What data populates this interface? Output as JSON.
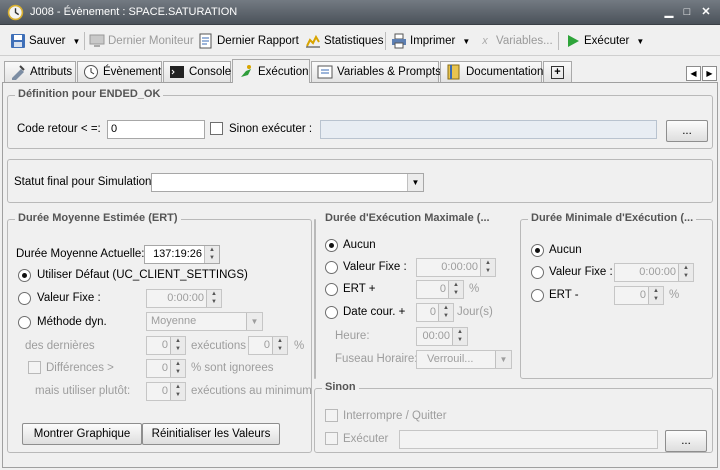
{
  "window": {
    "title": "J008 - Évènement : SPACE.SATURATION"
  },
  "toolbar": {
    "save": "Sauver",
    "last_monitor": "Dernier Moniteur",
    "last_report": "Dernier Rapport",
    "statistics": "Statistiques",
    "print": "Imprimer",
    "variables": "Variables...",
    "execute": "Exécuter"
  },
  "tabs": [
    "Attributs",
    "Évènement",
    "Console",
    "Exécution",
    "Variables & Prompts",
    "Documentation"
  ],
  "definition": {
    "legend": "Définition pour ENDED_OK",
    "code_label": "Code retour < =:",
    "code_value": "0",
    "else_label": "Sinon exécuter :",
    "browse": "..."
  },
  "simulation": {
    "label": "Statut final pour Simulation:",
    "value": ""
  },
  "ert": {
    "legend": "Durée Moyenne Estimée (ERT)",
    "current_label": "Durée Moyenne Actuelle:",
    "current_value": "137:19:26",
    "default_label": "Utiliser Défaut (UC_CLIENT_SETTINGS)",
    "fixed_label": "Valeur Fixe :",
    "fixed_value": "0:00:00",
    "dyn_label": "Méthode dyn.",
    "dyn_value": "Moyenne",
    "last_label": "des dernières",
    "last_value": "0",
    "exec_plus": "exécutions +",
    "exec_pct_value": "0",
    "pct": "%",
    "diff_label": "Différences >",
    "diff_value": "0",
    "ignored_label": "% sont ignorees",
    "rather_label": "mais utiliser plutôt:",
    "rather_value": "0",
    "min_label": "exécutions au minimum",
    "graph_btn": "Montrer Graphique",
    "reset_btn": "Réinitialiser les Valeurs"
  },
  "max": {
    "legend": "Durée d'Exécution Maximale (...",
    "none": "Aucun",
    "fixed": "Valeur Fixe :",
    "fixed_value": "0:00:00",
    "ert": "ERT +",
    "ert_value": "0",
    "pct": "%",
    "date": "Date cour. +",
    "date_value": "0",
    "days": "Jour(s)",
    "time_label": "Heure:",
    "time_value": "00:00",
    "tz_label": "Fuseau Horaire:",
    "tz_value": "Verrouil..."
  },
  "min": {
    "legend": "Durée Minimale d'Exécution (...",
    "none": "Aucun",
    "fixed": "Valeur Fixe :",
    "fixed_value": "0:00:00",
    "ert": "ERT -",
    "ert_value": "0",
    "pct": "%"
  },
  "sinon": {
    "legend": "Sinon",
    "abort": "Interrompre / Quitter",
    "execute": "Exécuter",
    "browse": "..."
  }
}
